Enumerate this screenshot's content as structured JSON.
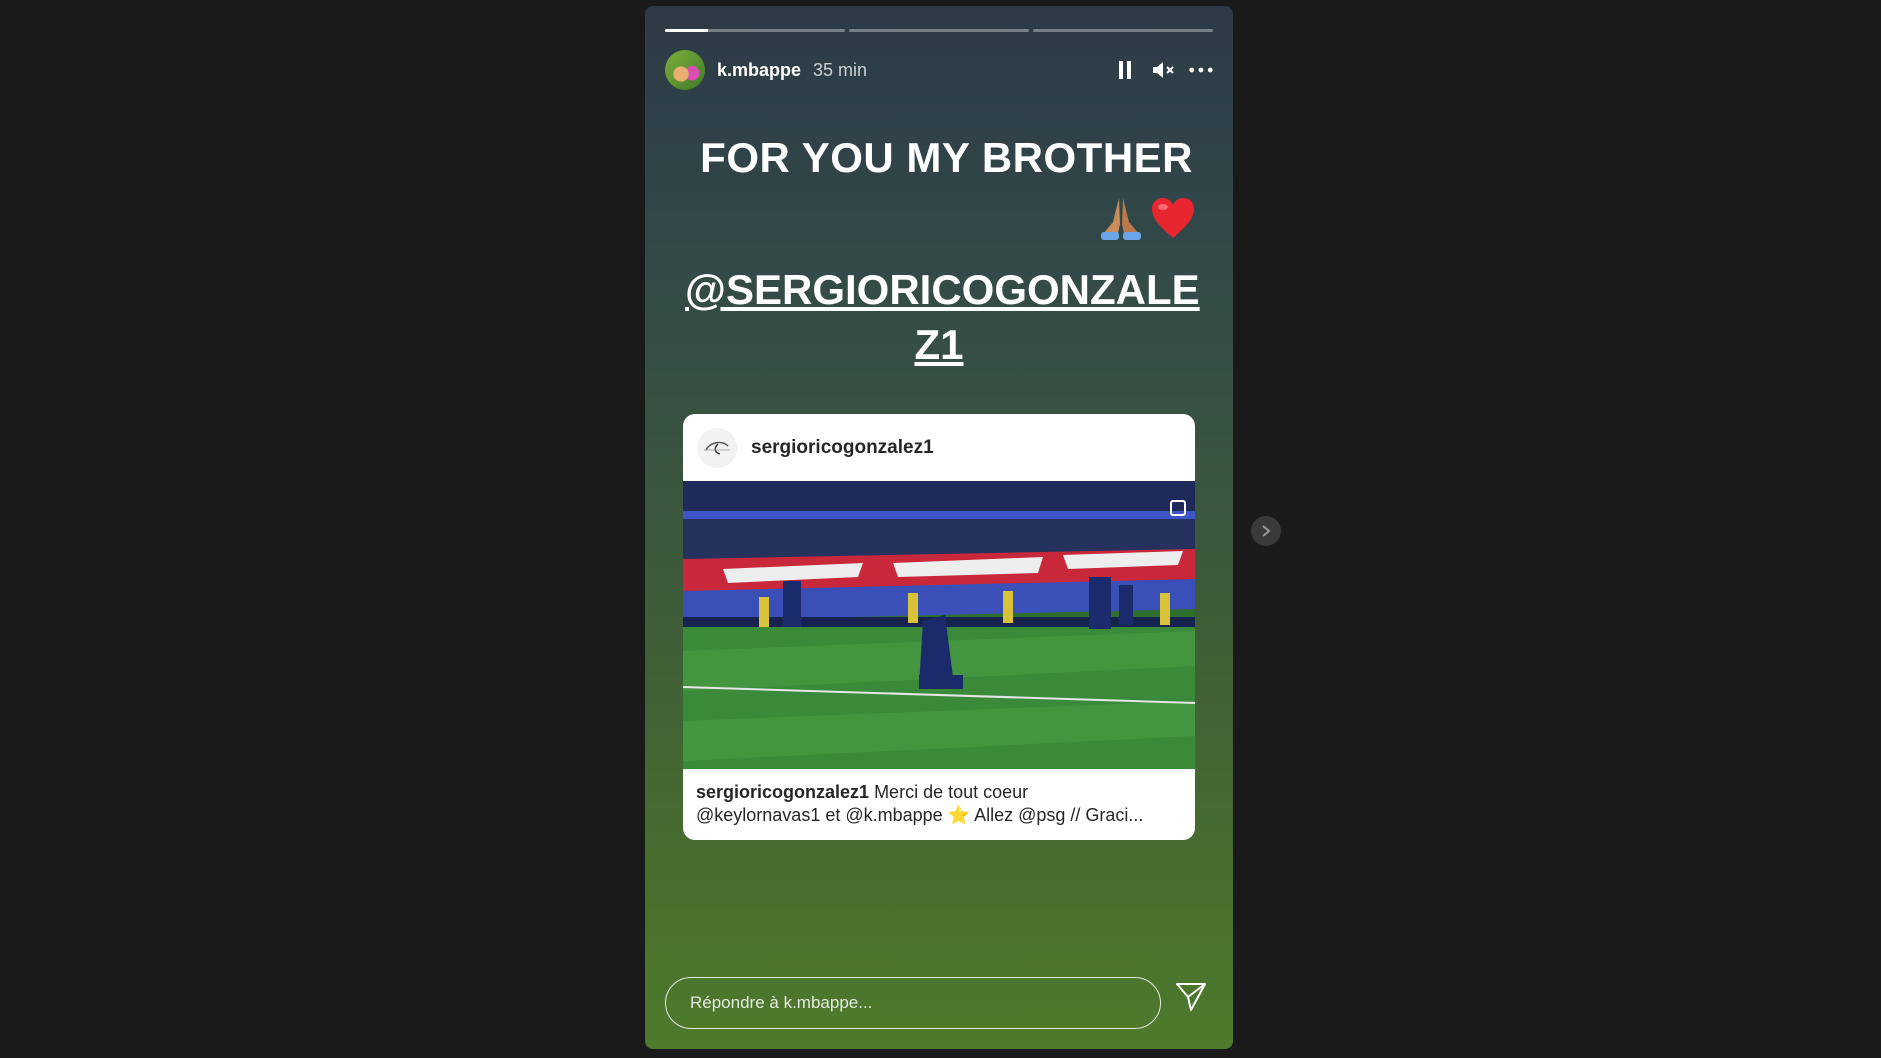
{
  "story": {
    "progress": [
      0.24,
      0,
      0
    ],
    "username": "k.mbappe",
    "time": "35 min",
    "title": "FOR YOU MY BROTHER",
    "mention_line1": "@SERGIORICOGONZALE",
    "mention_line2": "Z1"
  },
  "card": {
    "username": "sergioricogonzalez1",
    "caption_user": "sergioricogonzalez1",
    "caption_text1": " Merci de tout coeur",
    "caption_text2": "@keylornavas1 et @k.mbappe ⭐ Allez @psg // Graci..."
  },
  "reply": {
    "placeholder": "Répondre à k.mbappe..."
  },
  "icons": [
    "pause-icon",
    "mute-icon",
    "more-icon",
    "pray-emoji-icon",
    "heart-emoji-icon",
    "send-icon",
    "chevron-right-icon",
    "carousel-icon"
  ],
  "colors": {
    "heart": "#e8262f",
    "page_bg": "#1a1a1a"
  }
}
